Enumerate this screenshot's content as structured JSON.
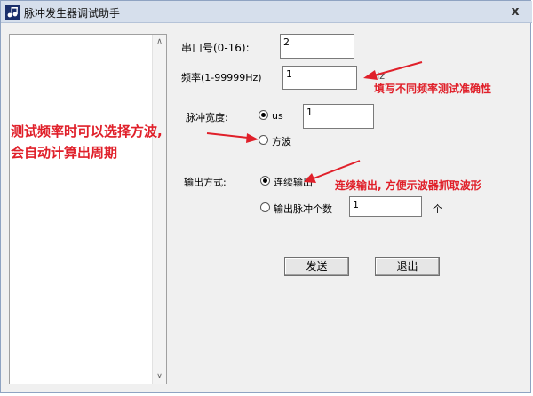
{
  "window": {
    "title": "脉冲发生器调试助手",
    "close_glyph": "x",
    "app_icon": "music-notes-icon"
  },
  "form": {
    "port_label": "串口号(0-16):",
    "port_value": "2",
    "freq_label": "频率(1-99999Hz)",
    "freq_value": "1",
    "freq_unit": "Hz",
    "pulse_width_label": "脉冲宽度:",
    "pulse_us_label": "us",
    "pulse_us_value": "1",
    "pulse_square_label": "方波",
    "output_mode_label": "输出方式:",
    "continuous_label": "连续输出",
    "count_label": "输出脉冲个数",
    "count_value": "1",
    "count_unit": "个"
  },
  "buttons": {
    "send": "发送",
    "exit": "退出"
  },
  "annotations": {
    "freq_note": "填写不同频率测试准确性",
    "left_note_line1": "测试频率时可以选择方波,",
    "left_note_line2": "会自动计算出周期",
    "output_note": "连续输出, 方便示波器抓取波形"
  },
  "colors": {
    "annotation": "#e0202a",
    "titlebar": "#d6dfec"
  }
}
